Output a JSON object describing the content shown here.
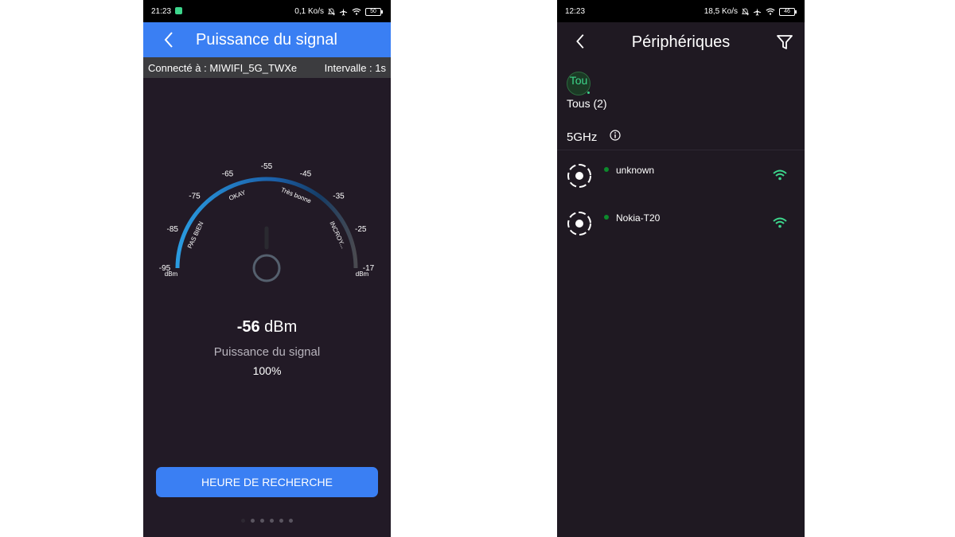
{
  "left_screen": {
    "status_bar": {
      "time": "21:23",
      "net_speed": "0,1 Ko/s",
      "battery": "50"
    },
    "app_bar": {
      "title": "Puissance du signal",
      "back_icon": "chevron-left-icon"
    },
    "connection_bar": {
      "connected": "Connecté à : MIWIFI_5G_TWXe",
      "interval": "Intervalle : 1s"
    },
    "gauge": {
      "ticks": [
        "-95",
        "-85",
        "-75",
        "-65",
        "-55",
        "-45",
        "-35",
        "-25",
        "-17"
      ],
      "zones": [
        "PAS BIEN",
        "OKAY",
        "Très bonne",
        "INCROY..."
      ],
      "unit_left": "dBm",
      "unit_right": "dBm",
      "value": -56,
      "min": -95,
      "max": -17
    },
    "reading": {
      "value": "-56",
      "unit": "dBm"
    },
    "subtitle": "Puissance du signal",
    "percent": "100%",
    "button": "HEURE DE RECHERCHE",
    "page_indicator": {
      "count": 6,
      "active": 0
    },
    "colors": {
      "accent": "#3a7ff3",
      "background": "#221a26"
    }
  },
  "right_screen": {
    "status_bar": {
      "time": "12:23",
      "net_speed": "18,5 Ko/s",
      "battery": "46"
    },
    "app_bar": {
      "title": "Périphériques",
      "back_icon": "chevron-left-icon",
      "filter_icon": "filter-icon"
    },
    "chip": {
      "label": "Tou"
    },
    "all_label": "Tous (2)",
    "band": "5GHz",
    "devices": [
      {
        "name": "unknown",
        "status_color": "#0c8a2c",
        "signal_icon": "wifi-icon"
      },
      {
        "name": "Nokia-T20",
        "status_color": "#0c8a2c",
        "signal_icon": "wifi-icon"
      }
    ],
    "colors": {
      "green": "#3dd68c",
      "background": "#1f1922"
    }
  }
}
